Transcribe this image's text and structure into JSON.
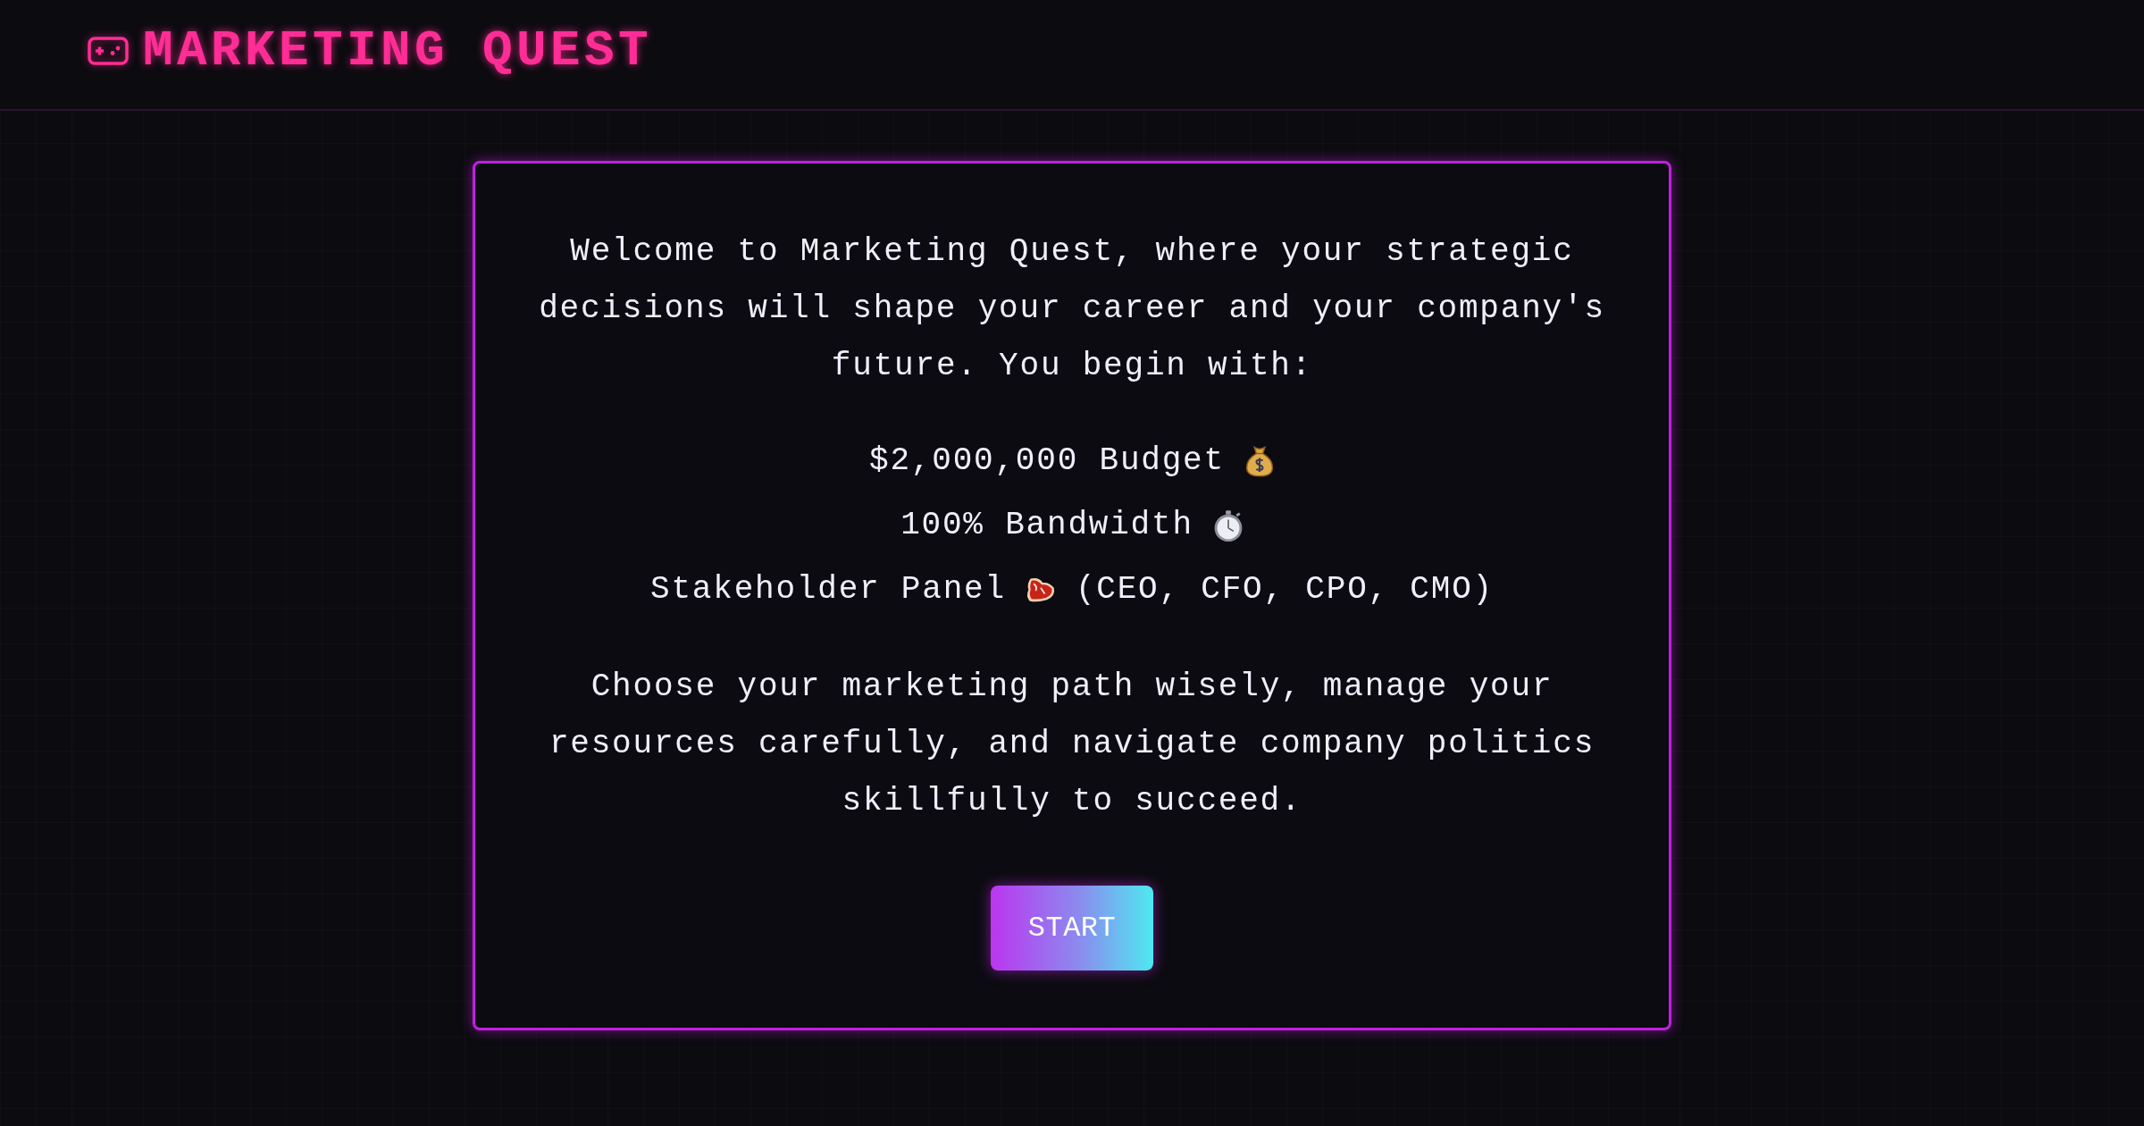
{
  "header": {
    "title": "MARKETING QUEST"
  },
  "intro": {
    "text": "Welcome to Marketing Quest, where your strategic decisions will shape your career and your company's future. You begin with:"
  },
  "resources": [
    {
      "kind": "budget",
      "label": "$2,000,000 Budget"
    },
    {
      "kind": "bandwidth",
      "label": "100% Bandwidth"
    },
    {
      "kind": "stakeholders",
      "label": "Stakeholder Panel",
      "detail": "(CEO, CFO, CPO, CMO)"
    }
  ],
  "outro": {
    "text": "Choose your marketing path wisely, manage your resources carefully, and navigate company politics skillfully to succeed."
  },
  "start_button": {
    "label": "START"
  }
}
